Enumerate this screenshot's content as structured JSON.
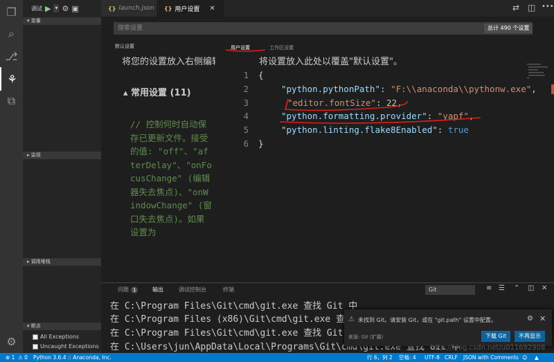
{
  "activity": {
    "icons": [
      "files-icon",
      "search-icon",
      "source-control-icon",
      "debug-icon",
      "extensions-icon",
      "settings-gear-icon"
    ]
  },
  "sidebar": {
    "debug_label": "调试",
    "debug_config": "▾",
    "sections": {
      "variables": "▾ 变量",
      "watch": "▸ 监视",
      "callstack": "▸ 调用堆栈",
      "breakpoints": "▾ 断点"
    },
    "breakpoints": [
      {
        "label": "All Exceptions",
        "checked": false
      },
      {
        "label": "Uncaught Exceptions",
        "checked": false
      }
    ]
  },
  "tabs": [
    {
      "icon": "{}",
      "label": "launch.json",
      "active": false
    },
    {
      "icon": "{}",
      "label": "用户设置",
      "active": true,
      "close": "✕"
    }
  ],
  "search": {
    "placeholder": "搜索设置",
    "count": "总计 490 个设置"
  },
  "default_pane": {
    "label": "默认设置",
    "hint": "将您的设置放入右侧编辑器以覆盖。",
    "section_title": "▴ 常用设置 (11)",
    "comment": "// 控制何时自动保存已更新文件。接受的值: \"off\"、\"afterDelay\"、\"onFocusChange\" (编辑器失去焦点)、\"onWindowChange\" (窗口失去焦点)。如果设置为"
  },
  "user_pane": {
    "tab_user": "用户设置",
    "tab_workspace": "工作区设置",
    "hint": "将设置放入此处以覆盖\"默认设置\"。",
    "line_numbers": [
      "1",
      "2",
      "3",
      "4",
      "5",
      "6"
    ],
    "lines": [
      {
        "brace": "{"
      },
      {
        "key": "\"python.pythonPath\"",
        "sep": ": ",
        "value": "\"F:\\\\anaconda\\\\pythonw.exe\"",
        "end": ","
      },
      {
        "key": "\"editor.fontSize\"",
        "sep": ": ",
        "value": "22",
        "end": ","
      },
      {
        "key": "\"python.formatting.provider\"",
        "sep": ": ",
        "value": "\"yapf\"",
        "end": ","
      },
      {
        "key": "\"python.linting.flake8Enabled\"",
        "sep": ": ",
        "value": "true",
        "end": ""
      },
      {
        "brace": "}"
      }
    ]
  },
  "panel": {
    "tabs": [
      {
        "label": "问题",
        "badge": "1"
      },
      {
        "label": "输出",
        "active": true
      },
      {
        "label": "调试控制台"
      },
      {
        "label": "终端"
      }
    ],
    "channel": "Git",
    "output": [
      "在 C:\\Program Files\\Git\\cmd\\git.exe 查找 Git 中",
      "在 C:\\Program Files (x86)\\Git\\cmd\\git.exe 查找 Git 中",
      "在 C:\\Program Files\\Git\\cmd\\git.exe 查找 Git 中",
      "在 C:\\Users\\jun\\AppData\\Local\\Programs\\Git\\cmd\\git.exe 查找 Git 中"
    ]
  },
  "notification": {
    "message": "未找到 Git。请安装 Git，或在 \"git.path\" 设置中配置。",
    "source": "来源: Git (扩展)",
    "primary": "下载 Git",
    "secondary": "不再显示"
  },
  "statusbar": {
    "errors": "⊗ 1",
    "warnings": "⚠ 0",
    "interpreter": "Python 3.6.4 :: Anaconda, Inc.",
    "position": "行 6，列 2",
    "spaces": "空格: 4",
    "encoding": "UTF-8",
    "eol": "CRLF",
    "language": "JSON with Comments"
  },
  "watermark": "http://blog.csdn.net/u011692908",
  "colors": {
    "accent": "#007acc",
    "annotation_red": "#e0201a",
    "json_key": "#9cdcfe",
    "json_string": "#ce9178",
    "json_number": "#b5cea8",
    "comment": "#608b4e"
  }
}
